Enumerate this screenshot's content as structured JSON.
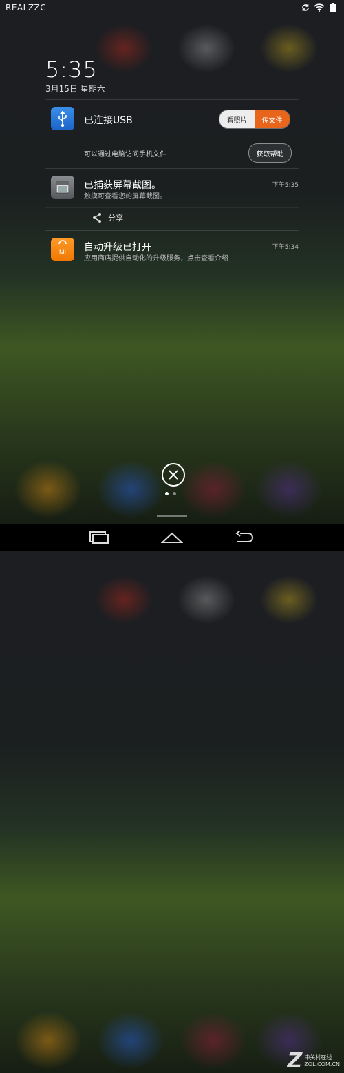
{
  "status_bar": {
    "carrier": "REALZZC",
    "icons": [
      "sync-icon",
      "wifi-icon",
      "battery-icon"
    ]
  },
  "lockscreen": {
    "time": "5:35",
    "date": "3月15日 星期六"
  },
  "notifications": {
    "usb": {
      "title": "已连接USB",
      "description": "可以通过电脑访问手机文件",
      "option_photos": "看照片",
      "option_files": "传文件",
      "help_label": "获取帮助",
      "icon": "usb-icon",
      "accent": "#e8651c"
    },
    "screenshot": {
      "title": "已捕获屏幕截图。",
      "description": "触摸可查看您的屏幕截图。",
      "time": "下午5:35",
      "share_label": "分享",
      "icon": "screenshot-icon"
    },
    "upgrade": {
      "title": "自动升级已打开",
      "description": "应用商店提供自动化的升级服务，点击查看介绍",
      "time": "下午5:34",
      "icon_text": "MI",
      "icon": "mi-store-icon"
    }
  },
  "pager": {
    "pages": 2,
    "current": 1
  },
  "nav_bar": {
    "icons": [
      "recent-apps-icon",
      "home-icon",
      "back-icon"
    ]
  },
  "watermark": {
    "logo": "Z",
    "line1": "中关村在线",
    "line2": "ZOL.COM.CN"
  }
}
